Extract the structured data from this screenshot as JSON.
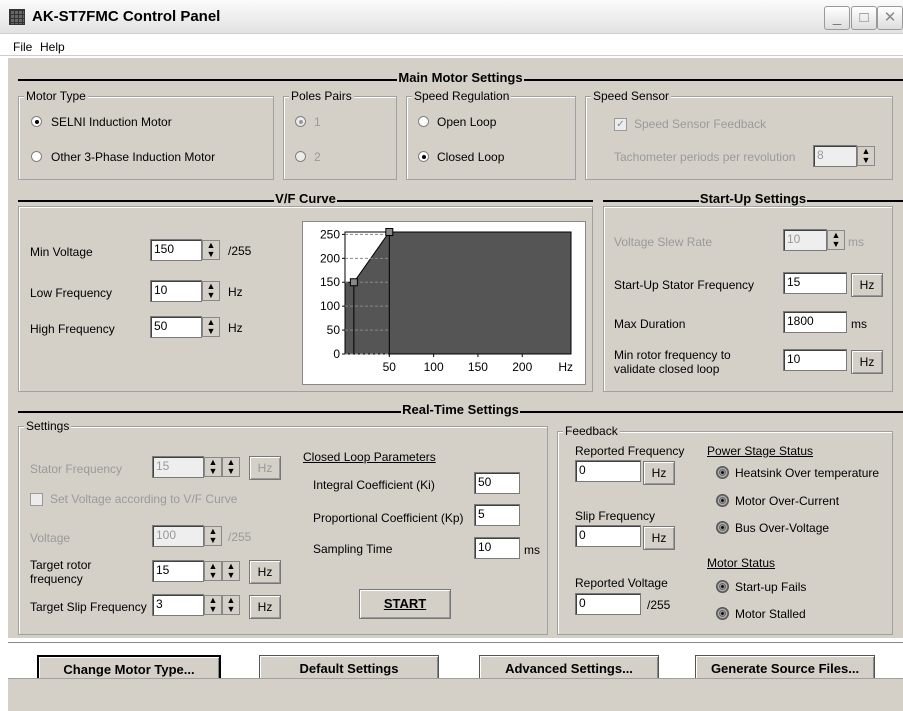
{
  "window": {
    "title": "AK-ST7FMC Control Panel"
  },
  "menu": [
    "File",
    "Help"
  ],
  "main": {
    "title": "Main Motor Settings",
    "motor_type": {
      "title": "Motor Type",
      "options": [
        "SELNI Induction Motor",
        "Other 3-Phase Induction Motor"
      ],
      "selected": 0
    },
    "poles": {
      "title": "Poles Pairs",
      "options": [
        "1",
        "2"
      ]
    },
    "speed_reg": {
      "title": "Speed Regulation",
      "options": [
        "Open Loop",
        "Closed Loop"
      ],
      "selected": 1
    },
    "sensor": {
      "title": "Speed Sensor",
      "feedback_label": "Speed Sensor Feedback",
      "tacho_label": "Tachometer periods per revolution",
      "tacho_value": "8"
    }
  },
  "vf": {
    "title": "V/F Curve",
    "min_voltage": {
      "label": "Min Voltage",
      "value": "150",
      "unit": "/255"
    },
    "low_freq": {
      "label": "Low Frequency",
      "value": "10",
      "unit": "Hz"
    },
    "high_freq": {
      "label": "High Frequency",
      "value": "50",
      "unit": "Hz"
    }
  },
  "chart_data": {
    "type": "line",
    "x": [
      0,
      10,
      50,
      255
    ],
    "y": [
      150,
      150,
      255,
      255
    ],
    "xlabel": "Hz",
    "ylabel": "",
    "xlim": [
      0,
      255
    ],
    "ylim": [
      0,
      255
    ],
    "xticks": [
      "50",
      "100",
      "150",
      "200"
    ],
    "yticks": [
      "0",
      "50",
      "100",
      "150",
      "200",
      "250"
    ],
    "colors": {
      "fill": "#555555",
      "line": "#000000"
    }
  },
  "startup": {
    "title": "Start-Up Settings",
    "slew": {
      "label": "Voltage Slew Rate",
      "value": "10",
      "unit": "ms"
    },
    "stator": {
      "label": "Start-Up Stator Frequency",
      "value": "15",
      "unit": "Hz"
    },
    "maxdur": {
      "label": "Max Duration",
      "value": "1800",
      "unit": "ms"
    },
    "minrotor": {
      "label1": "Min rotor frequency to",
      "label2": "validate closed loop",
      "value": "10",
      "unit": "Hz"
    }
  },
  "rt": {
    "title": "Real-Time Settings",
    "settings": {
      "title": "Settings",
      "stator": {
        "label": "Stator Frequency",
        "value": "15",
        "unit": "Hz"
      },
      "setv_label": "Set Voltage according to V/F Curve",
      "voltage": {
        "label": "Voltage",
        "value": "100",
        "unit": "/255"
      },
      "target_rotor": {
        "label1": "Target rotor",
        "label2": "frequency",
        "value": "15",
        "unit": "Hz"
      },
      "target_slip": {
        "label": "Target Slip Frequency",
        "value": "3",
        "unit": "Hz"
      }
    },
    "cl": {
      "title": "Closed Loop Parameters",
      "ki": {
        "label": "Integral Coefficient (Ki)",
        "value": "50"
      },
      "kp": {
        "label": "Proportional Coefficient (Kp)",
        "value": "5"
      },
      "st": {
        "label": "Sampling Time",
        "value": "10",
        "unit": "ms"
      }
    },
    "start_label": "START",
    "feedback": {
      "title": "Feedback",
      "freq": {
        "label": "Reported Frequency",
        "value": "0",
        "unit": "Hz"
      },
      "slip": {
        "label": "Slip Frequency",
        "value": "0",
        "unit": "Hz"
      },
      "voltage": {
        "label": "Reported Voltage",
        "value": "0",
        "unit": "/255"
      },
      "power_title": "Power Stage Status",
      "power": [
        "Heatsink Over temperature",
        "Motor Over-Current",
        "Bus Over-Voltage"
      ],
      "motor_title": "Motor Status",
      "motor": [
        "Start-up Fails",
        "Motor Stalled"
      ]
    }
  },
  "buttons": {
    "change": "Change Motor Type...",
    "default": "Default Settings",
    "advanced": "Advanced Settings...",
    "generate": "Generate Source Files..."
  }
}
